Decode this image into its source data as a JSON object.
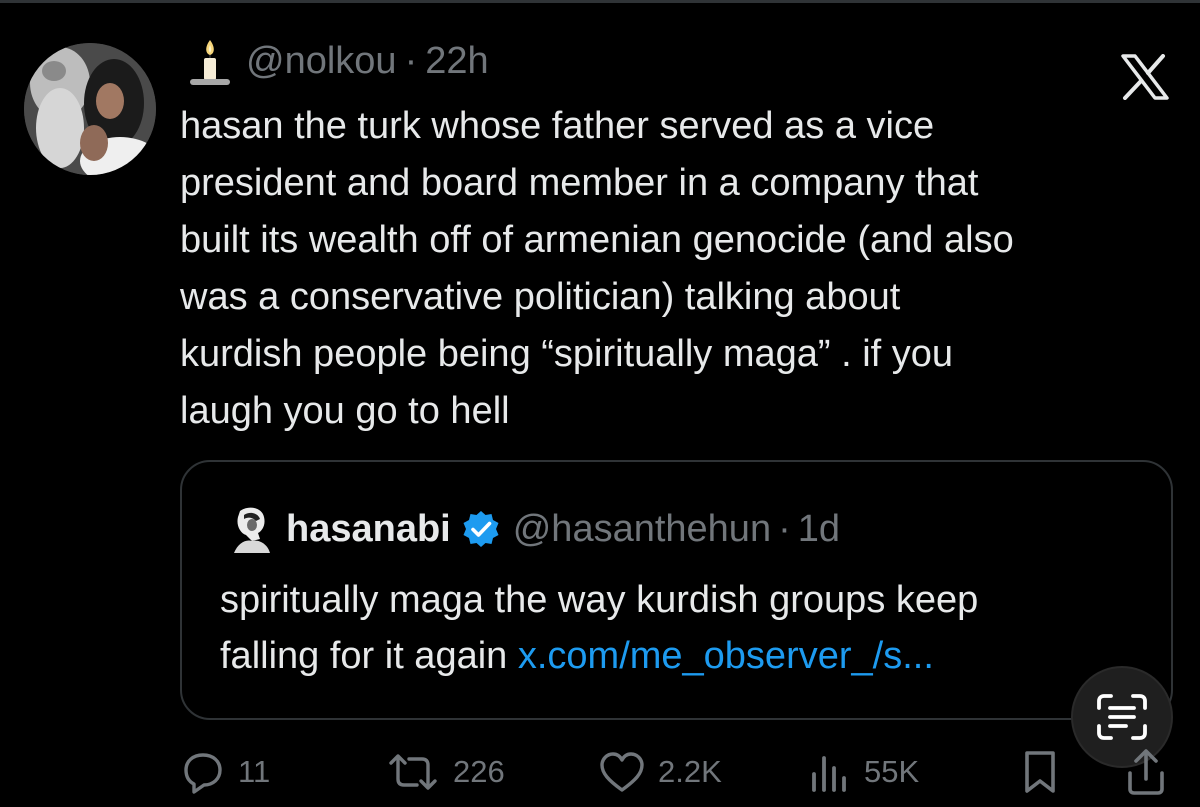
{
  "tweet": {
    "author_handle": "@nolkou",
    "separator": "·",
    "timestamp": "22h",
    "emoji_icon": "candle-icon",
    "lines": [
      "hasan the turk whose father served as a vice",
      "president and board member in a company that",
      "built its wealth off of armenian genocide (and also",
      "was a conservative politician) talking about",
      "kurdish people being “spiritually maga” . if you",
      "laugh you go to hell"
    ]
  },
  "quote": {
    "display_name": "hasanabi",
    "handle": "@hasanthehun",
    "separator": "·",
    "timestamp": "1d",
    "verified_icon": "verified-badge-icon",
    "line1": "spiritually maga the way kurdish groups keep",
    "line2_text": "falling for it again ",
    "link": "x.com/me_observer_/s..."
  },
  "actions": {
    "replies": "11",
    "reposts": "226",
    "likes": "2.2K",
    "views": "55K"
  },
  "icons": {
    "brand": "x-logo-icon",
    "reply": "reply-icon",
    "repost": "repost-icon",
    "like": "heart-icon",
    "views": "views-icon",
    "bookmark": "bookmark-icon",
    "share": "share-icon",
    "scan": "text-scan-icon"
  },
  "colors": {
    "background": "#000000",
    "text": "#e7e9ea",
    "secondary": "#71767b",
    "link": "#1d9bf0",
    "border": "#2f3336"
  }
}
